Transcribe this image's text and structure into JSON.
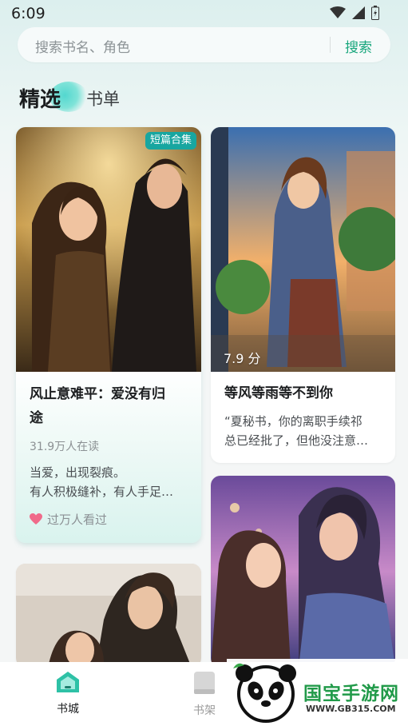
{
  "status_bar": {
    "time": "6:09",
    "icons": [
      "wifi-icon",
      "signal-icon",
      "battery-icon"
    ]
  },
  "search": {
    "placeholder": "搜索书名、角色",
    "button_label": "搜索"
  },
  "tabs": [
    {
      "label": "精选",
      "active": true
    },
    {
      "label": "书单",
      "active": false
    }
  ],
  "books": [
    {
      "badge": "短篇合集",
      "title_line1": "风止意难平：爱没有归",
      "title_line2": "途",
      "readers": "31.9万人在读",
      "desc_line1": "当爱，出现裂痕。",
      "desc_line2": "有人积极缝补，有人手足…",
      "tag": "过万人看过",
      "tag_icon": "heart-icon"
    },
    {
      "score": "7.9 分",
      "title": "等风等雨等不到你",
      "desc_line1": "“夏秘书，你的离职手续祁",
      "desc_line2": "总已经批了，但他没注意…"
    }
  ],
  "bottom_nav": [
    {
      "label": "书城",
      "icon": "home-icon",
      "active": true
    },
    {
      "label": "书架",
      "icon": "bookshelf-icon",
      "active": false
    }
  ],
  "watermark": {
    "title": "国宝手游网",
    "url": "WWW.GB315.COM"
  },
  "colors": {
    "accent": "#18a67c",
    "badge": "#18a6a0",
    "tab_highlight": "#53d7cf"
  }
}
